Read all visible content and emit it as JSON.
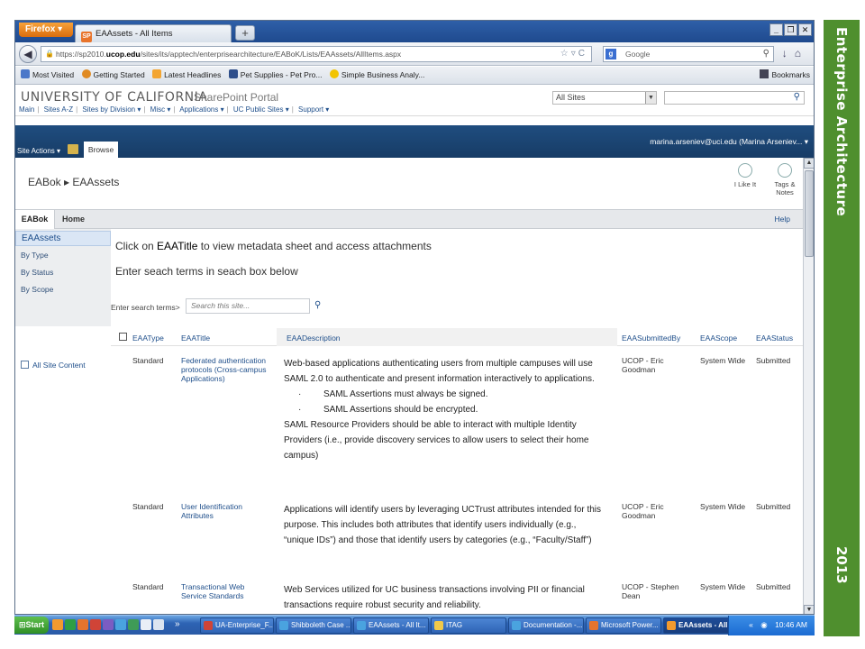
{
  "browser": {
    "app_button": "Firefox",
    "tab_favicon": "SP",
    "tab_title": "EAAssets - All Items",
    "new_tab": "+",
    "url_host": "https://sp2010.",
    "url_bold": "ucop.edu",
    "url_path": "/sites/its/apptech/enterprisearchitecture/EABoK/Lists/EAAssets/AllItems.aspx",
    "search_engine": "Google",
    "bookmarks": [
      "Most Visited",
      "Getting Started",
      "Latest Headlines",
      "Pet Supplies - Pet Pro...",
      "Simple Business Analy..."
    ],
    "bookmarks_menu": "Bookmarks"
  },
  "portal": {
    "logo": "UNIVERSITY OF CALIFORNIA",
    "portal_name": "SharePoint Portal",
    "nav": [
      "Main",
      "Sites A-Z",
      "Sites by Division ▾",
      "Misc ▾",
      "Applications ▾",
      "UC Public Sites ▾",
      "Support ▾"
    ],
    "scope": "All Sites",
    "site_actions": "Site Actions ▾",
    "browse_tab": "Browse",
    "user": "marina.arseniev@uci.edu (Marina Arseniev... ▾",
    "breadcrumb": "EABok  ▸ EAAssets",
    "i_like_it": "I Like It",
    "tags_notes_1": "Tags &",
    "tags_notes_2": "Notes",
    "topnav_eabok": "EABok",
    "topnav_home": "Home",
    "topnav_help": "Help"
  },
  "quicklaunch": {
    "selected": "EAAssets",
    "items": [
      "By Type",
      "By Status",
      "By Scope"
    ],
    "all_site_content": "All Site Content"
  },
  "content": {
    "intro_pre": "Click on ",
    "intro_bold": "EAATitle",
    "intro_post": " to view metadata sheet and access attachments",
    "intro2": "Enter seach terms in seach box below",
    "search_label": "Enter search terms>",
    "search_placeholder": "Search this site...",
    "columns": [
      "EAAType",
      "EAATitle",
      "EAADescription",
      "EAASubmittedBy",
      "EAAScope",
      "EAAStatus"
    ],
    "rows": [
      {
        "type": "Standard",
        "title_lines": [
          "Federated authentication",
          "protocols (Cross-campus",
          "Applications)"
        ],
        "desc_lines": [
          "Web-based applications authenticating users from multiple campuses will use",
          "SAML 2.0 to authenticate and present information interactively to applications."
        ],
        "bullets": [
          "SAML Assertions must always be signed.",
          "SAML Assertions should be encrypted."
        ],
        "desc_after": [
          "SAML Resource Providers should be able to interact with multiple Identity",
          "Providers (i.e., provide discovery services to allow users to select their home",
          "campus)"
        ],
        "submitted_lines": [
          "UCOP - Eric",
          "Goodman"
        ],
        "scope": "System Wide",
        "status": "Submitted"
      },
      {
        "type": "Standard",
        "title_lines": [
          "User Identification",
          "Attributes"
        ],
        "desc_lines": [
          "Applications will identify users by leveraging UCTrust attributes intended for this",
          "purpose. This includes both attributes that identify users individually (e.g.,",
          "“unique IDs”) and those that identify users by categories (e.g., “Faculty/Staff”)"
        ],
        "submitted_lines": [
          "UCOP - Eric",
          "Goodman"
        ],
        "scope": "System Wide",
        "status": "Submitted"
      },
      {
        "type": "Standard",
        "title_lines": [
          "Transactional Web",
          "Service Standards"
        ],
        "desc_lines": [
          "Web Services utilized for UC business transactions involving PII or financial",
          "transactions require robust security and reliability."
        ],
        "submitted_lines": [
          "UCOP - Stephen",
          "Dean"
        ],
        "scope": "System Wide",
        "status": "Submitted"
      }
    ]
  },
  "taskbar": {
    "start": "Start",
    "chevron": "»",
    "tasks": [
      "UA-Enterprise_F...",
      "Shibboleth Case ...",
      "EAAssets - All It...",
      "ITAG",
      "Documentation -...",
      "Microsoft Power...",
      "EAAssets - All ..."
    ],
    "tray_chevron": "«",
    "time": "10:46 AM"
  },
  "banner": {
    "title": "Enterprise Architecture",
    "year": "2013"
  },
  "colors": {
    "banner_green": "#4f8f2e",
    "ribbon_blue": "#1f4d7f",
    "link_blue": "#1f4f8b"
  }
}
